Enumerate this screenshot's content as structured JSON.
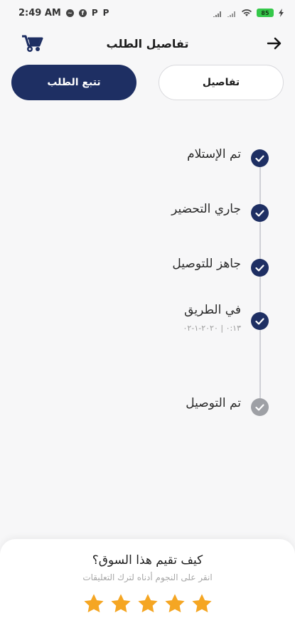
{
  "status_bar": {
    "time": "2:49 AM",
    "battery": "85"
  },
  "header": {
    "title": "تفاصيل الطلب"
  },
  "tabs": [
    {
      "label": "تفاصيل"
    },
    {
      "label": "تتبع الطلب"
    }
  ],
  "timeline": {
    "steps": [
      {
        "label": "تم الإستلام",
        "status": "done"
      },
      {
        "label": "جاري التحضير",
        "status": "done"
      },
      {
        "label": "جاهز للتوصيل",
        "status": "done"
      },
      {
        "label": "في الطريق",
        "sub": "٠:١٣ | ٢٠٢٠-١-٠٢",
        "status": "done"
      },
      {
        "label": "تم التوصيل",
        "status": "pending"
      }
    ]
  },
  "rating": {
    "title": "كيف تقيم هذا السوق؟",
    "subtitle": "انقر على النجوم أدناه لترك التعليقات",
    "stars": 5
  },
  "colors": {
    "primary": "#1e2f63",
    "star": "#f5a623",
    "pending": "#9ea0a5"
  }
}
